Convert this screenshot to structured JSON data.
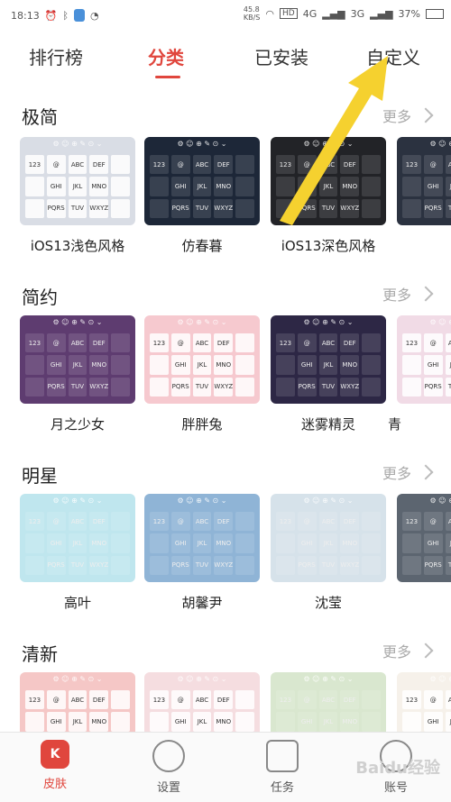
{
  "status_bar": {
    "time": "18:13",
    "net_speed": "45.8\nKB/S",
    "hd": "HD",
    "sig1": "4G",
    "sig2": "3G",
    "battery": "37%"
  },
  "tabs": [
    {
      "label": "排行榜"
    },
    {
      "label": "分类"
    },
    {
      "label": "已安装"
    },
    {
      "label": "自定义"
    }
  ],
  "more_label": "更多",
  "sections": [
    {
      "title": "极简",
      "items": [
        "iOS13浅色风格",
        "仿春暮",
        "iOS13深色风格"
      ],
      "colors": [
        "#d9dde5",
        "#1d2738",
        "#222327",
        "#2b3240"
      ]
    },
    {
      "title": "简约",
      "items": [
        "月之少女",
        "胖胖兔",
        "迷雾精灵",
        "青"
      ],
      "colors": [
        "#5e3c70",
        "#f6c9cf",
        "#2d2745",
        "#f1dbe6"
      ]
    },
    {
      "title": "明星",
      "items": [
        "高叶",
        "胡馨尹",
        "沈莹"
      ],
      "colors": [
        "#bfe6ee",
        "#8fb4d6",
        "#d6e2ea",
        "#5c6570"
      ]
    },
    {
      "title": "清新",
      "items": [],
      "colors": [
        "#f5c7c6",
        "#f5dde0",
        "#d9e7cf",
        "#f6f1ea"
      ]
    }
  ],
  "keys": [
    "@",
    "ABC",
    "DEF",
    "GHI",
    "JKL",
    "MNO",
    "PQRS",
    "TUV",
    "WXYZ",
    "123"
  ],
  "bottom_nav": [
    {
      "label": "皮肤"
    },
    {
      "label": "设置"
    },
    {
      "label": "任务"
    },
    {
      "label": "账号"
    }
  ],
  "watermark": "Baidu经验",
  "colors": {
    "accent": "#e0463d",
    "arrow": "#f5d12f"
  }
}
